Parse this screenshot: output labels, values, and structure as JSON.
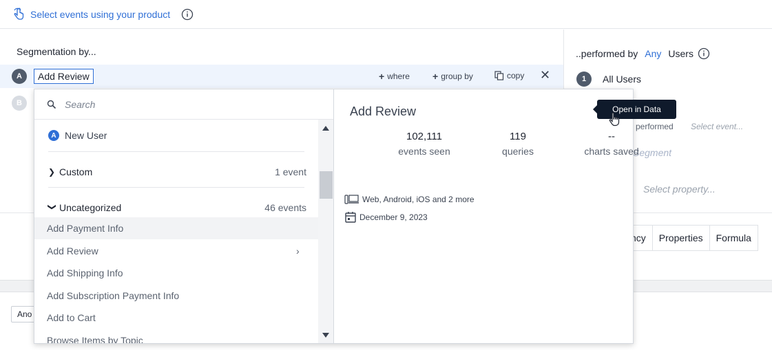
{
  "topbar": {
    "link_text": "Select events using your product"
  },
  "segmentation": {
    "title": "Segmentation by...",
    "rows": [
      {
        "badge": "A",
        "event": "Add Review"
      },
      {
        "badge": "B"
      }
    ],
    "actions": {
      "where": "where",
      "group_by": "group by",
      "copy": "copy"
    }
  },
  "performed": {
    "prefix": "..performed by",
    "any": "Any",
    "users": "Users",
    "item_badge": "1",
    "item_label": "All Users",
    "ghost_performed": "o performed",
    "ghost_select_event": "Select event...",
    "ghost_segment": "Segment",
    "ghost_select_property": "Select property..."
  },
  "tabs": [
    "ncy",
    "Properties",
    "Formula"
  ],
  "bottom": {
    "ano_button": "Ano"
  },
  "dropdown": {
    "search_placeholder": "Search",
    "new_user": "New User",
    "groups": [
      {
        "label": "Custom",
        "count": "1 event"
      },
      {
        "label": "Uncategorized",
        "count": "46 events"
      }
    ],
    "events": [
      "Add Payment Info",
      "Add Review",
      "Add Shipping Info",
      "Add Subscription Payment Info",
      "Add to Cart",
      "Browse Items by Topic"
    ]
  },
  "detail": {
    "title": "Add Review",
    "stats": [
      {
        "value": "102,111",
        "label": "events seen"
      },
      {
        "value": "119",
        "label": "queries"
      },
      {
        "value": "--",
        "label": "charts saved"
      }
    ],
    "platforms": "Web, Android, iOS and 2 more",
    "date": "December 9, 2023",
    "tooltip": "Open in Data"
  },
  "colors": {
    "accent": "#2f6fd6",
    "tooltip_bg": "#0f1a2b",
    "highlight_row": "#eef4fd"
  }
}
